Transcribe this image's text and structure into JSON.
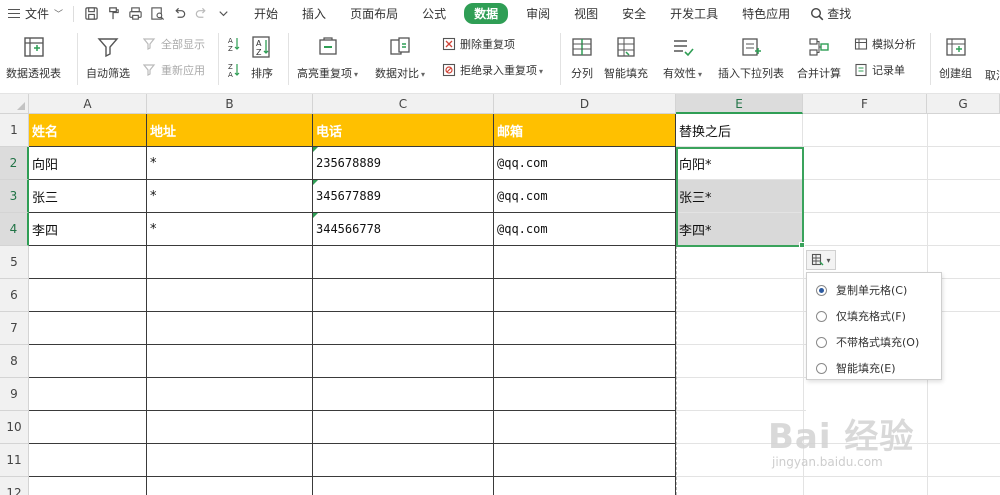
{
  "menubar": {
    "file_label": "文件",
    "tabs": [
      "开始",
      "插入",
      "页面布局",
      "公式",
      "数据",
      "审阅",
      "视图",
      "安全",
      "开发工具",
      "特色应用"
    ],
    "active_tab": "数据",
    "search_label": "查找"
  },
  "ribbon": {
    "pivot": "数据透视表",
    "autofilter": "自动筛选",
    "show_all": "全部显示",
    "reapply": "重新应用",
    "sort": "排序",
    "highlight_dup": "高亮重复项",
    "compare": "数据对比",
    "delete_dup": "删除重复项",
    "reject_dup": "拒绝录入重复项",
    "split_col": "分列",
    "smart_fill": "智能填充",
    "validity": "有效性",
    "insert_dropdown": "插入下拉列表",
    "merge_calc": "合并计算",
    "simulate": "模拟分析",
    "record_form": "记录单",
    "create_group": "创建组",
    "cancel_group": "取消"
  },
  "sheet": {
    "columns": [
      "A",
      "B",
      "C",
      "D",
      "E",
      "F",
      "G"
    ],
    "rows": [
      "1",
      "2",
      "3",
      "4",
      "5",
      "6",
      "7",
      "8",
      "9",
      "10",
      "11",
      "12"
    ],
    "headers": [
      "姓名",
      "地址",
      "电话",
      "邮箱",
      "替换之后"
    ],
    "data": [
      [
        "向阳",
        "*",
        "235678889",
        "@qq.com",
        "向阳*"
      ],
      [
        "张三",
        "*",
        "345677889",
        "@qq.com",
        "张三*"
      ],
      [
        "李四",
        "*",
        "344566778",
        "@qq.com",
        "李四*"
      ]
    ],
    "header_color": "#ffc000",
    "selection_color": "#3aa35c"
  },
  "autofill_menu": {
    "options": [
      "复制单元格(C)",
      "仅填充格式(F)",
      "不带格式填充(O)",
      "智能填充(E)"
    ],
    "selected_index": 0
  },
  "watermark": {
    "main": "Bai 经验",
    "sub": "jingyan.baidu.com"
  }
}
